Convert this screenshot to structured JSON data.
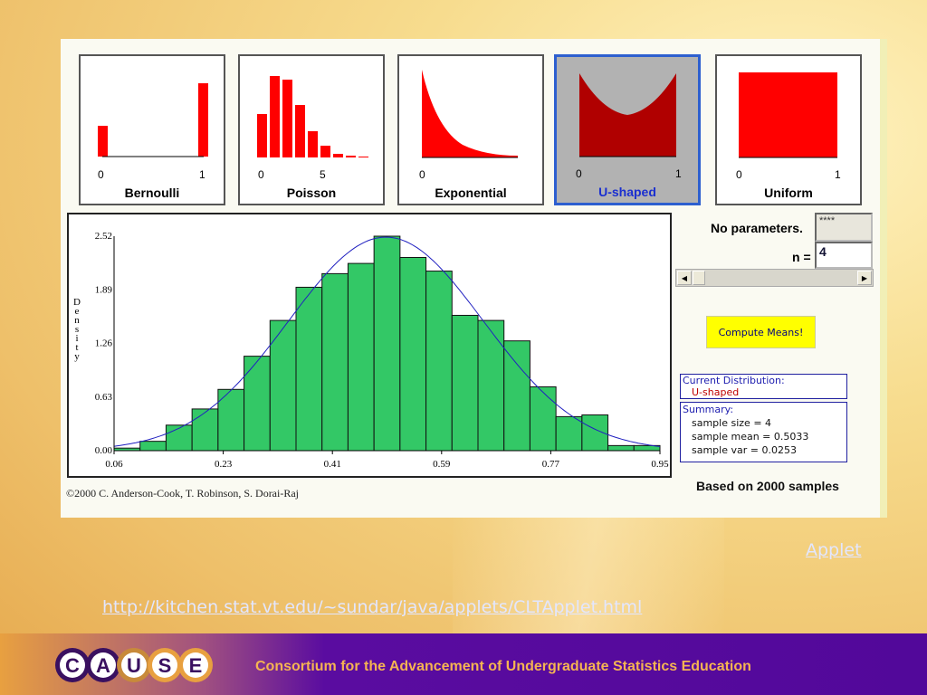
{
  "thumbnails": [
    {
      "label": "Bernoulli",
      "ticks": [
        "0",
        "1"
      ]
    },
    {
      "label": "Poisson",
      "ticks": [
        "0",
        "5"
      ]
    },
    {
      "label": "Exponential",
      "ticks": [
        "0"
      ]
    },
    {
      "label": "U-shaped",
      "ticks": [
        "0",
        "1"
      ],
      "selected": true
    },
    {
      "label": "Uniform",
      "ticks": [
        "0",
        "1"
      ]
    }
  ],
  "controls": {
    "no_parameters": "No parameters.",
    "param_value": "****",
    "n_label": "n =",
    "n_value": "4",
    "compute_label": "Compute Means!"
  },
  "current_distribution": {
    "title": "Current Distribution:",
    "value": "U-shaped"
  },
  "summary": {
    "title": "Summary:",
    "size": "sample size = 4",
    "mean": "sample mean = 0.5033",
    "var": "sample var = 0.0253"
  },
  "based_on": "Based on 2000 samples",
  "copyright": "©2000 C. Anderson-Cook, T. Robinson, S. Dorai-Raj",
  "links": {
    "applet": "Applet",
    "url": "http://kitchen.stat.vt.edu/~sundar/java/applets/CLTApplet.html"
  },
  "footer": {
    "logo_letters": [
      "C",
      "A",
      "U",
      "S",
      "E"
    ],
    "text": "Consortium for the Advancement of Undergraduate Statistics Education"
  },
  "colors": {
    "bars": "#33c866",
    "curve": "#2020c0",
    "thumb_red": "#ff0000",
    "footer": "#52089a"
  },
  "chart_data": {
    "type": "bar",
    "title": "",
    "xlabel": "",
    "ylabel": "Density",
    "xlim": [
      0.06,
      0.95
    ],
    "ylim": [
      0,
      2.52
    ],
    "xticks": [
      "0.06",
      "0.23",
      "0.41",
      "0.59",
      "0.77",
      "0.95"
    ],
    "yticks": [
      "0.00",
      "0.63",
      "1.26",
      "1.89",
      "2.52"
    ],
    "bin_count": 21,
    "values": [
      0.03,
      0.11,
      0.3,
      0.49,
      0.72,
      1.11,
      1.53,
      1.92,
      2.08,
      2.2,
      2.52,
      2.27,
      2.11,
      1.59,
      1.53,
      1.29,
      0.75,
      0.4,
      0.42,
      0.06,
      0.06
    ],
    "normal_curve": {
      "mean": 0.5033,
      "sd": 0.159
    }
  }
}
